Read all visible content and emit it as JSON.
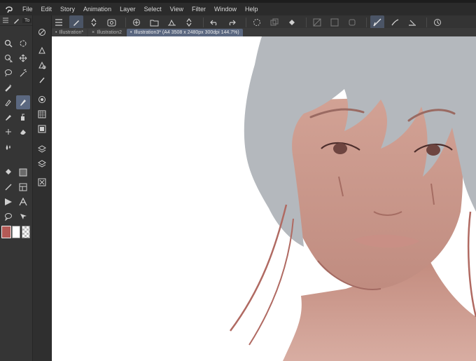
{
  "menu": {
    "items": [
      "File",
      "Edit",
      "Story",
      "Animation",
      "Layer",
      "Select",
      "View",
      "Filter",
      "Window",
      "Help"
    ]
  },
  "toolbox": {
    "header_label": "To"
  },
  "tabs": [
    {
      "label": "Illustration*",
      "mark": "•",
      "active": false
    },
    {
      "label": "Illustration2",
      "mark": "×",
      "active": false
    },
    {
      "label": "Illustration3* (A4 3508 x 2480px 300dpi 144.7%)",
      "mark": "•",
      "active": true
    }
  ],
  "colors": {
    "main_color": "#b35a56",
    "sub_color": "#ffffff",
    "accent": "#5b6880",
    "canvas": "#ffffff"
  }
}
